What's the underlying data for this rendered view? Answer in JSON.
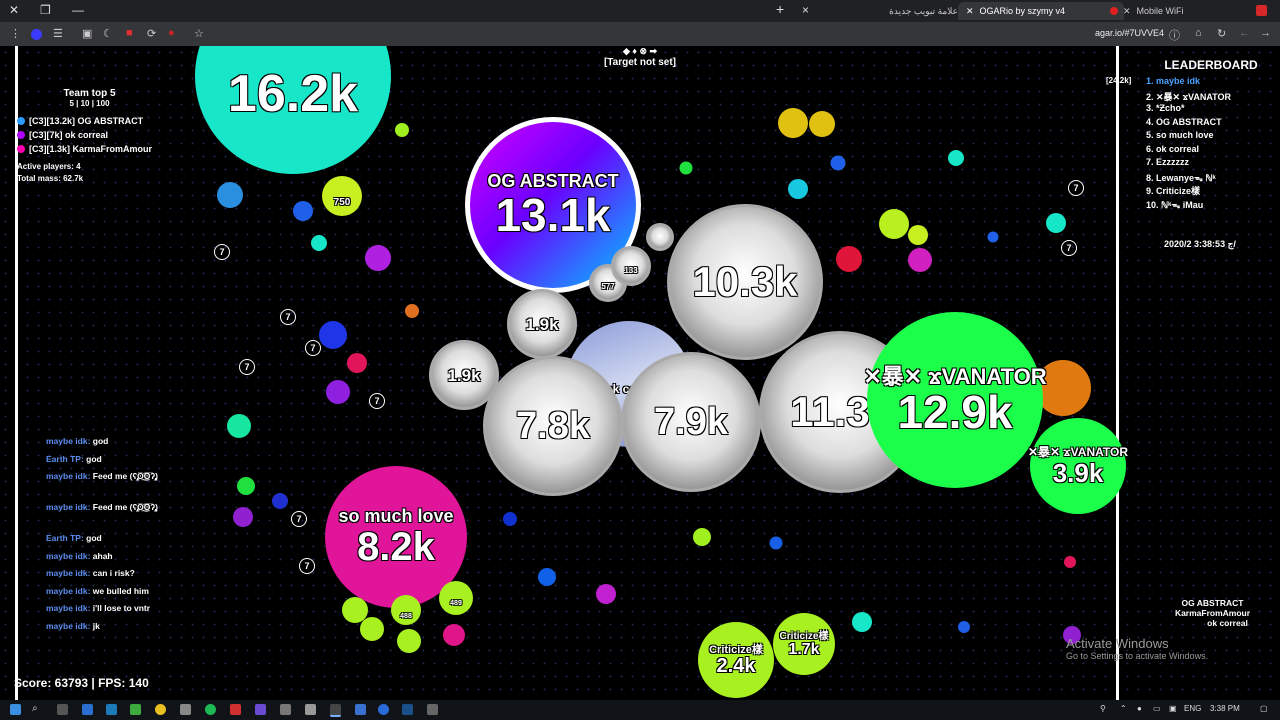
{
  "browser": {
    "tabs": [
      {
        "label": "علامة تبويب جديدة",
        "active": false
      },
      {
        "label": "OGARio by szymy v4",
        "active": true
      },
      {
        "label": "Mobile WiFi",
        "active": false
      }
    ],
    "url": "agar.io/#7UVVE4",
    "new_tab_glyph": "+",
    "close_glyph": "×"
  },
  "hud": {
    "target": "[Target not set]",
    "team_top": {
      "title": "Team top 5",
      "subtitle": "5 | 10 | 100",
      "rows": [
        {
          "num": "1",
          "text": "[C3][13.2k] OG ABSTRACT",
          "color": "#2b9bff"
        },
        {
          "num": "2",
          "text": "[C3][7k] ok correal",
          "color": "#b000ff"
        },
        {
          "num": "3",
          "text": "[C3][1.3k] KarmaFromAmour",
          "color": "#ff00b0"
        }
      ],
      "active_players": "Active players: 4",
      "total_mass": "Total mass: 62.7k"
    },
    "leaderboard": {
      "title": "LEADERBOARD",
      "entries": [
        "1. maybe idk",
        "2. ✕暴✕ ϫVANATOR",
        "3. *Ƶcho*",
        "4. OG ABSTRACT",
        "5. so much love",
        "6. ok correal",
        "7. Ezzzzzz",
        "8. Lewanyeᯓ ℕᵏ",
        "9. Criticize樣",
        "10. ℕᵏᯓ iMau"
      ]
    },
    "mass_indicator": "[24.2k]",
    "timestamp": "ج 3:38:53 2020/2/",
    "chat": [
      {
        "who": "maybe idk:",
        "msg": "god"
      },
      {
        "who": "Earth TP:",
        "msg": "god"
      },
      {
        "who": "maybe idk:",
        "msg": "Feed me (ʕ̡̢̡ʘ̅͟͜͡ʘ̲̅ʔ̢̡̢)"
      },
      {
        "who": "maybe idk:",
        "msg": "Feed me (ʕ̡̢̡ʘ̅͟͜͡ʘ̲̅ʔ̢̡̢)"
      },
      {
        "who": "Earth TP:",
        "msg": "god"
      },
      {
        "who": "maybe idk:",
        "msg": "ahah"
      },
      {
        "who": "maybe idk:",
        "msg": "can i risk?"
      },
      {
        "who": "maybe idk:",
        "msg": "we bulled him"
      },
      {
        "who": "maybe idk:",
        "msg": "i'll lose to vntr"
      },
      {
        "who": "maybe idk:",
        "msg": "jk"
      }
    ],
    "score": "Score: 63793 | FPS: 140",
    "minimap_names": [
      "OG ABSTRACT",
      "KarmaFromAmour",
      "ok correal"
    ],
    "activate_title": "Activate Windows",
    "activate_sub": "Go to Settings to activate Windows."
  },
  "cells": {
    "top_cyan": "16.2k",
    "og_name": "OG ABSTRACT",
    "og_mass": "13.1k",
    "big1": "10.3k",
    "small1": "1.9k",
    "small2": "1.9k",
    "c78": "7.8k",
    "c79": "7.9k",
    "c113": "11.3",
    "okcor_name": "ok corre",
    "vanator_name": "✕暴✕ ϫVANATOR",
    "vanator_mass": "12.9k",
    "vanator2_name": "✕暴✕ ϫVANATOR",
    "vanator2_mass": "3.9k",
    "love_name": "so much love",
    "love_mass": "8.2k",
    "crit_name": "Criticize樣",
    "crit_mass": "2.4k",
    "crit2_name": "Criticize樣",
    "crit2_mass": "1.7k",
    "yellow_mass": "750",
    "k577": "577",
    "k133": "133",
    "g488": "488",
    "g489": "489"
  },
  "taskbar": {
    "lang": "ENG",
    "time": "3:38 PM"
  },
  "colors": {
    "accent_green": "#1cff4a",
    "magenta": "#e0159a",
    "cyan": "#17e6c8",
    "chat_name": "#5b8df0"
  }
}
